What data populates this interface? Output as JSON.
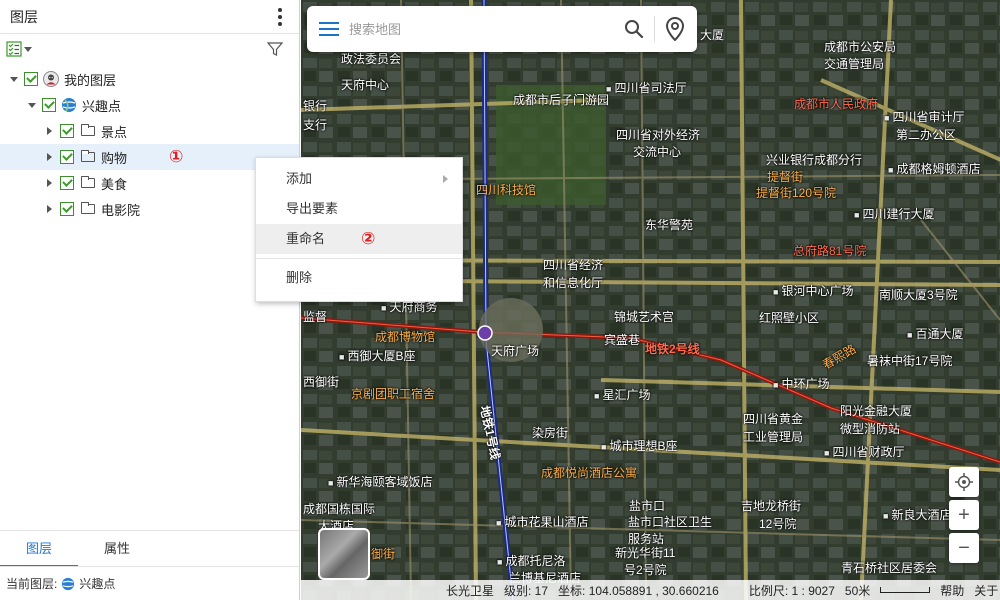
{
  "panel": {
    "title": "图层",
    "tree": [
      {
        "label": "我的图层",
        "level": 0,
        "expanded": true,
        "icon": "user-avatar-icon"
      },
      {
        "label": "兴趣点",
        "level": 1,
        "expanded": true,
        "icon": "globe-icon"
      },
      {
        "label": "景点",
        "level": 2,
        "expanded": false,
        "icon": "folder-icon"
      },
      {
        "label": "购物",
        "level": 2,
        "expanded": false,
        "icon": "folder-icon",
        "selected": true
      },
      {
        "label": "美食",
        "level": 2,
        "expanded": false,
        "icon": "folder-icon"
      },
      {
        "label": "电影院",
        "level": 2,
        "expanded": false,
        "icon": "folder-icon"
      }
    ],
    "step1": "①",
    "tabs": [
      "图层",
      "属性"
    ],
    "current_layer_label": "当前图层:",
    "current_layer_value": "兴趣点"
  },
  "search": {
    "placeholder": "搜索地图"
  },
  "context_menu": {
    "items": [
      "添加",
      "导出要素",
      "重命名",
      "删除"
    ],
    "step2": "②"
  },
  "map_labels": {
    "l1": "政法委员会",
    "l2": "天府中心",
    "l3": "银行",
    "l4": "支行",
    "l5": "成都市后子门游园",
    "l6": "四川省司法厅",
    "l7": "四川省对外经济",
    "l8": "交流中心",
    "l9": "四川科技馆",
    "l10": "东华警苑",
    "l11": "四川省经济",
    "l12": "和信息化厅",
    "l13": "大厦",
    "l14": "成都市公安局",
    "l15": "交通管理局",
    "l16": "成都市人民政府",
    "l17": "四川省审计厅",
    "l18": "第二办公区",
    "l19": "兴业银行成都分行",
    "l20": "提督街",
    "l21": "提督街120号院",
    "l22": "成都格姆顿酒店",
    "l23": "四川建行大厦",
    "l24": "总府路81号院",
    "l25": "锦城艺术宫",
    "l26": "银河中心广场",
    "l27": "南顺大厦3号院",
    "l28": "红照壁小区",
    "l29": "百通大厦",
    "l30": "暑袜中街17号院",
    "l31": "天府广场",
    "l32": "宾盛巷",
    "l33": "地铁2号线",
    "l34": "成都博物馆",
    "l35": "西御大厦B座",
    "l36": "京剧团职工宿舍",
    "l37": "星汇广场",
    "l38": "中环广场",
    "l39": "阳光金融大厦",
    "l40": "四川省黄金",
    "l41": "工业管理局",
    "l42": "微型消防站",
    "l43": "四川省财政厅",
    "l44": "地铁1号线",
    "l45": "染房街",
    "l46": "城市理想B座",
    "l47": "成都悦尚酒店公寓",
    "l48": "新华海颐客域饭店",
    "l49": "成都国栋国际",
    "l50": "大酒店",
    "l51": "城市花果山酒店",
    "l52": "盐市口社区卫生",
    "l53": "服务站",
    "l54": "新光华街11",
    "l55": "号2号院",
    "l56": "吉地龙桥街",
    "l57": "12号院",
    "l58": "新良大酒店",
    "l59": "青石桥社区居委会",
    "l60": "成都托尼洛",
    "l61": "兰博基尼酒店",
    "l62": "盐市口",
    "l63": "西御街",
    "l64": "监督",
    "l65": "春熙路",
    "l66": "天府商务",
    "l67": "东御街"
  },
  "map_status": {
    "source": "长光卫星",
    "level": "级别: 17",
    "coords": "坐标: 104.058891 , 30.660216",
    "scale": "比例尺: 1 : 9027",
    "scale_unit": "50米",
    "help": "帮助",
    "about": "关于"
  },
  "controls": {
    "zoom_in": "+",
    "zoom_out": "−"
  },
  "colors": {
    "accent": "#1d7ad6",
    "check": "#3a9a2a",
    "badge": "#e02020"
  }
}
